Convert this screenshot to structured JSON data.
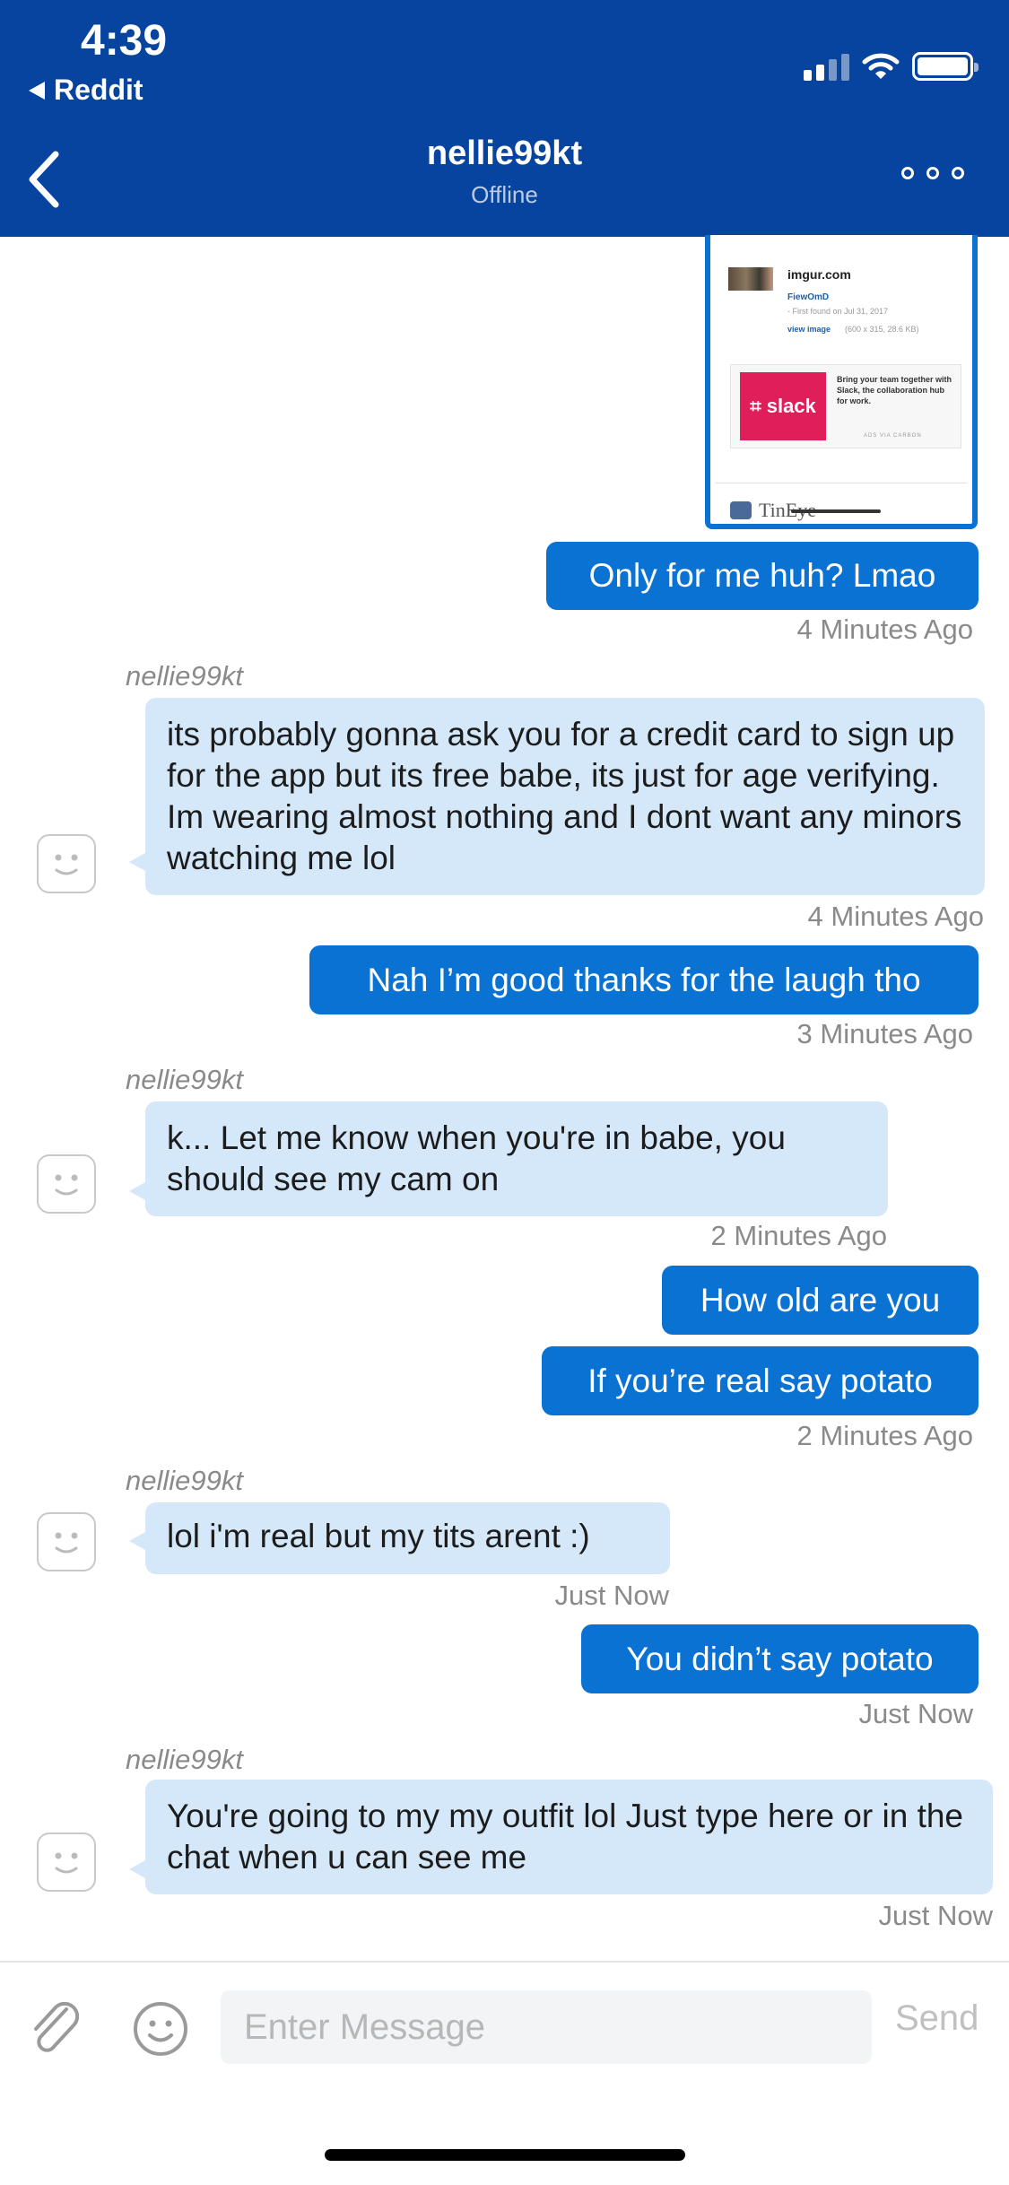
{
  "status_bar": {
    "time": "4:39",
    "back_app": "Reddit"
  },
  "header": {
    "title": "nellie99kt",
    "subtitle": "Offline"
  },
  "link_preview": {
    "site": "imgur.com",
    "id": "FiewOmD",
    "found": "- First found on Jul 31, 2017",
    "view_link": "view image",
    "dims": "(600 x 315, 28.6 KB)",
    "ad_brand": "slack",
    "ad_text": "Bring your team together with Slack, the collaboration hub for work.",
    "ads_via": "ADS VIA CARBON",
    "footer": "TinEye"
  },
  "messages": [
    {
      "dir": "out",
      "text": "Only for me huh? Lmao",
      "time": "4 Minutes Ago"
    },
    {
      "dir": "in",
      "sender": "nellie99kt",
      "text": "its probably gonna ask you for a credit card to sign up for the app but its free babe,  its just for age verifying. Im wearing almost nothing and I dont want any minors watching me lol",
      "time": "4 Minutes Ago"
    },
    {
      "dir": "out",
      "text": "Nah I’m good thanks for the laugh tho",
      "time": "3 Minutes Ago"
    },
    {
      "dir": "in",
      "sender": "nellie99kt",
      "text": "k... Let me know when you're in babe, you should see my cam on",
      "time": "2 Minutes Ago"
    },
    {
      "dir": "out",
      "text": "How old are you",
      "time": ""
    },
    {
      "dir": "out",
      "text": "If you’re real say potato",
      "time": "2 Minutes Ago"
    },
    {
      "dir": "in",
      "sender": "nellie99kt",
      "text": "lol i'm real but my tits arent :)",
      "time": "Just Now"
    },
    {
      "dir": "out",
      "text": "You didn’t say potato",
      "time": "Just Now"
    },
    {
      "dir": "in",
      "sender": "nellie99kt",
      "text": "You're going to my my outfit lol Just type here or in the chat when u can see me",
      "time": "Just Now"
    }
  ],
  "composer": {
    "placeholder": "Enter Message",
    "send_label": "Send"
  },
  "icons": {
    "back": "chevron-left-icon",
    "more": "more-dots-icon",
    "attach": "paperclip-icon",
    "emoji": "smiley-icon",
    "avatar": "avatar-placeholder-icon"
  },
  "colors": {
    "header_bg": "#0744a0",
    "outgoing_bubble": "#0a72d2",
    "incoming_bubble": "#d4e8fa"
  }
}
